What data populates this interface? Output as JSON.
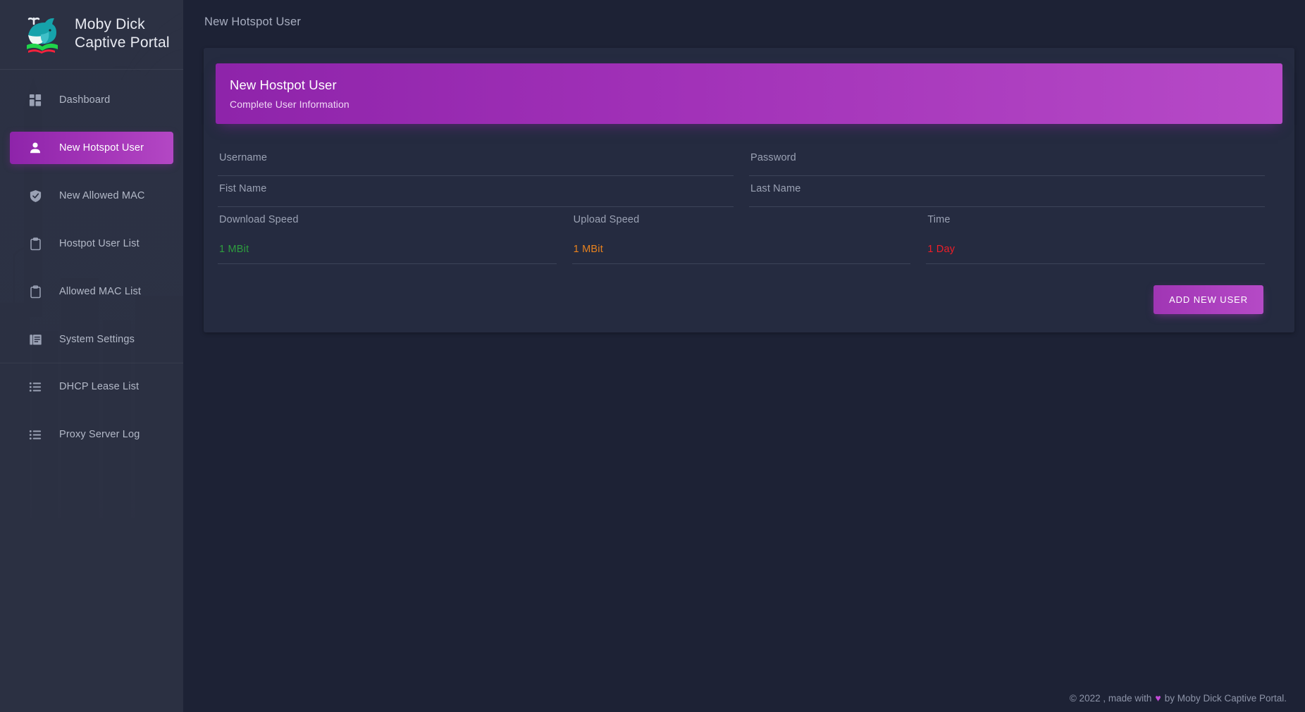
{
  "brand": {
    "name": "Moby Dick\nCaptive Portal",
    "logo_icon": "whale-book-logo"
  },
  "sidebar": {
    "items": [
      {
        "label": "Dashboard",
        "icon": "dashboard-grid-icon",
        "active": false
      },
      {
        "label": "New Hotspot User",
        "icon": "person-icon",
        "active": true
      },
      {
        "label": "New Allowed MAC",
        "icon": "shield-check-icon",
        "active": false
      },
      {
        "label": "Hostpot User List",
        "icon": "clipboard-icon",
        "active": false
      },
      {
        "label": "Allowed MAC List",
        "icon": "clipboard-icon",
        "active": false
      },
      {
        "label": "System Settings",
        "icon": "document-list-icon",
        "active": false
      },
      {
        "label": "DHCP Lease List",
        "icon": "list-icon",
        "active": false
      },
      {
        "label": "Proxy Server Log",
        "icon": "list-icon",
        "active": false
      }
    ]
  },
  "header": {
    "title": "New Hotspot User"
  },
  "card": {
    "title": "New Hostpot User",
    "subtitle": "Complete User Information"
  },
  "form": {
    "username": {
      "label": "Username",
      "value": "",
      "placeholder": ""
    },
    "password": {
      "label": "Password",
      "value": "",
      "placeholder": ""
    },
    "first_name": {
      "label": "Fist Name",
      "value": "",
      "placeholder": ""
    },
    "last_name": {
      "label": "Last Name",
      "value": "",
      "placeholder": ""
    },
    "download_speed": {
      "label": "Download Speed",
      "value": "1 MBit",
      "color": "#2e9e3e"
    },
    "upload_speed": {
      "label": "Upload Speed",
      "value": "1 MBit",
      "color": "#e8821e"
    },
    "time": {
      "label": "Time",
      "value": "1 Day",
      "color": "#f01e28"
    }
  },
  "actions": {
    "add_user_label": "ADD NEW USER"
  },
  "footer": {
    "prefix": "© 2022 , made with",
    "heart": "♥",
    "suffix": "by Moby Dick Captive Portal."
  },
  "colors": {
    "accent_purple": "#8e24aa",
    "sidebar_bg": "#2b3042",
    "page_bg": "#1d2235",
    "card_bg": "#252b40"
  }
}
